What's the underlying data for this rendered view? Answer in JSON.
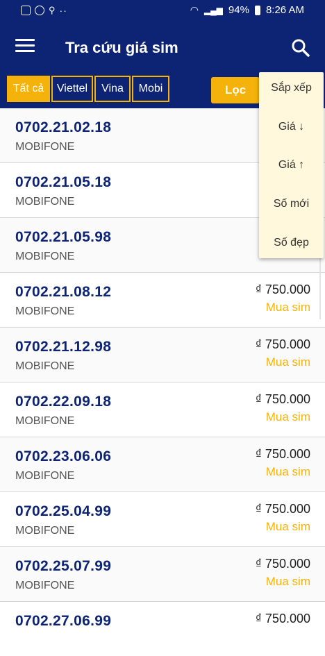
{
  "status_bar": {
    "battery": "94%",
    "time": "8:26 AM"
  },
  "app_bar": {
    "title": "Tra cứu giá sim"
  },
  "filters": {
    "tabs": [
      {
        "label": "Tất cả",
        "active": true
      },
      {
        "label": "Viettel",
        "active": false
      },
      {
        "label": "Vina",
        "active": false
      },
      {
        "label": "Mobi",
        "active": false
      }
    ],
    "filter_button": "Lọc"
  },
  "sort_menu": {
    "items": [
      "Sắp xếp",
      "Giá ↓",
      "Giá ↑",
      "Số mới",
      "Số đẹp"
    ]
  },
  "sims": [
    {
      "number": "0702.21.02.18",
      "carrier": "MOBIFONE",
      "price": "₫",
      "buy": ""
    },
    {
      "number": "0702.21.05.18",
      "carrier": "MOBIFONE",
      "price": "₫",
      "buy": ""
    },
    {
      "number": "0702.21.05.98",
      "carrier": "MOBIFONE",
      "price": "₫",
      "buy": ""
    },
    {
      "number": "0702.21.08.12",
      "carrier": "MOBIFONE",
      "price": "₫ 750.000",
      "buy": "Mua sim"
    },
    {
      "number": "0702.21.12.98",
      "carrier": "MOBIFONE",
      "price": "₫ 750.000",
      "buy": "Mua sim"
    },
    {
      "number": "0702.22.09.18",
      "carrier": "MOBIFONE",
      "price": "₫ 750.000",
      "buy": "Mua sim"
    },
    {
      "number": "0702.23.06.06",
      "carrier": "MOBIFONE",
      "price": "₫ 750.000",
      "buy": "Mua sim"
    },
    {
      "number": "0702.25.04.99",
      "carrier": "MOBIFONE",
      "price": "₫ 750.000",
      "buy": "Mua sim"
    },
    {
      "number": "0702.25.07.99",
      "carrier": "MOBIFONE",
      "price": "₫ 750.000",
      "buy": "Mua sim"
    },
    {
      "number": "0702.27.06.99",
      "carrier": "",
      "price": "₫ 750.000",
      "buy": ""
    }
  ],
  "colors": {
    "primary": "#0d2474",
    "accent": "#f5b20a"
  }
}
